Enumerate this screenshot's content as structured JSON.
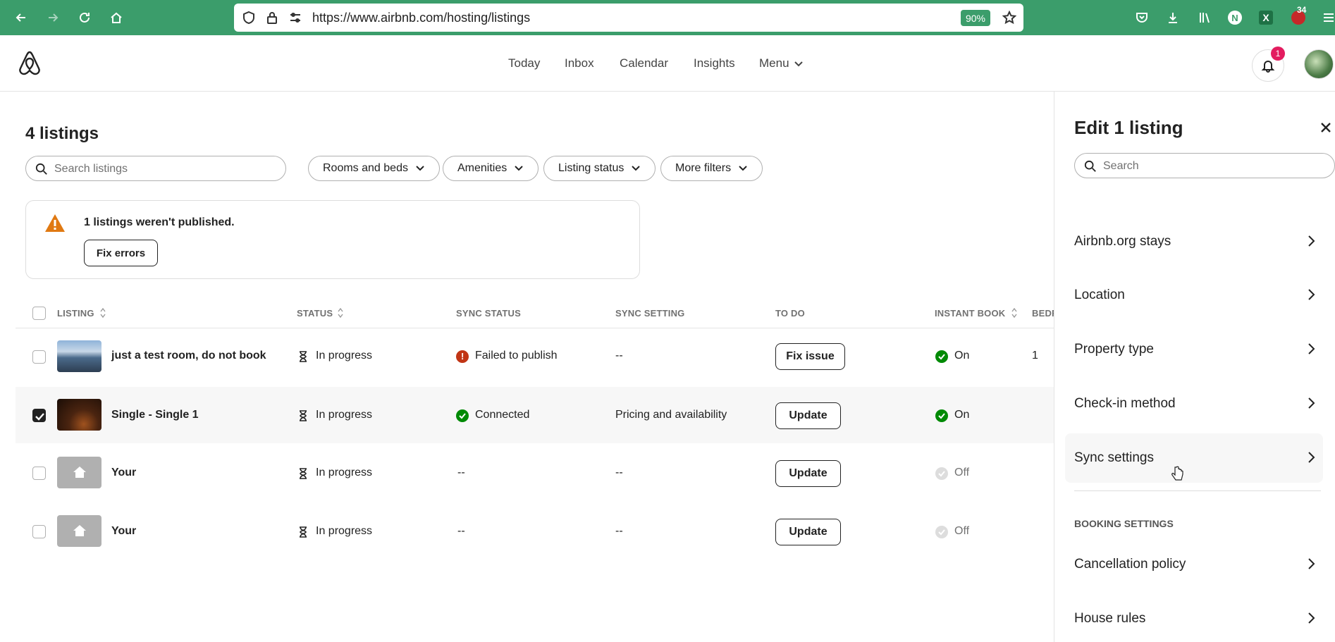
{
  "browser": {
    "url": "https://www.airbnb.com/hosting/listings",
    "zoom": "90%",
    "ext_badge": "34",
    "profile_initial": "N"
  },
  "nav": {
    "items": [
      "Today",
      "Inbox",
      "Calendar",
      "Insights",
      "Menu"
    ],
    "notification_count": "1"
  },
  "page": {
    "title": "4 listings",
    "search_placeholder": "Search listings",
    "filters": [
      "Rooms and beds",
      "Amenities",
      "Listing status",
      "More filters"
    ],
    "alert": {
      "text": "1 listings weren't published.",
      "button": "Fix errors"
    }
  },
  "table": {
    "headers": [
      "LISTING",
      "STATUS",
      "SYNC STATUS",
      "SYNC SETTING",
      "TO DO",
      "INSTANT BOOK",
      "BEDR"
    ],
    "rows": [
      {
        "name": "just a test room, do not book",
        "status": "In progress",
        "sync_status": "Failed to publish",
        "sync_setting": "--",
        "todo": "Fix issue",
        "instant_book": "On",
        "bedrooms": "1",
        "selected": false
      },
      {
        "name": "Single - Single 1",
        "status": "In progress",
        "sync_status": "Connected",
        "sync_setting": "Pricing and availability",
        "todo": "Update",
        "instant_book": "On",
        "bedrooms": "",
        "selected": true
      },
      {
        "name": "Your",
        "status": "In progress",
        "sync_status": "--",
        "sync_setting": "--",
        "todo": "Update",
        "instant_book": "Off",
        "bedrooms": "",
        "selected": false
      },
      {
        "name": "Your",
        "status": "In progress",
        "sync_status": "--",
        "sync_setting": "--",
        "todo": "Update",
        "instant_book": "Off",
        "bedrooms": "",
        "selected": false
      }
    ]
  },
  "panel": {
    "title": "Edit 1 listing",
    "search_placeholder": "Search",
    "items": [
      "Airbnb.org stays",
      "Location",
      "Property type",
      "Check-in method",
      "Sync settings"
    ],
    "section_header": "BOOKING SETTINGS",
    "booking_items": [
      "Cancellation policy",
      "House rules"
    ]
  },
  "colors": {
    "browser_bar": "#3b9d6b",
    "brand": "#e31c5f",
    "success": "#008a05",
    "error": "#c13515",
    "warning": "#e07912"
  }
}
